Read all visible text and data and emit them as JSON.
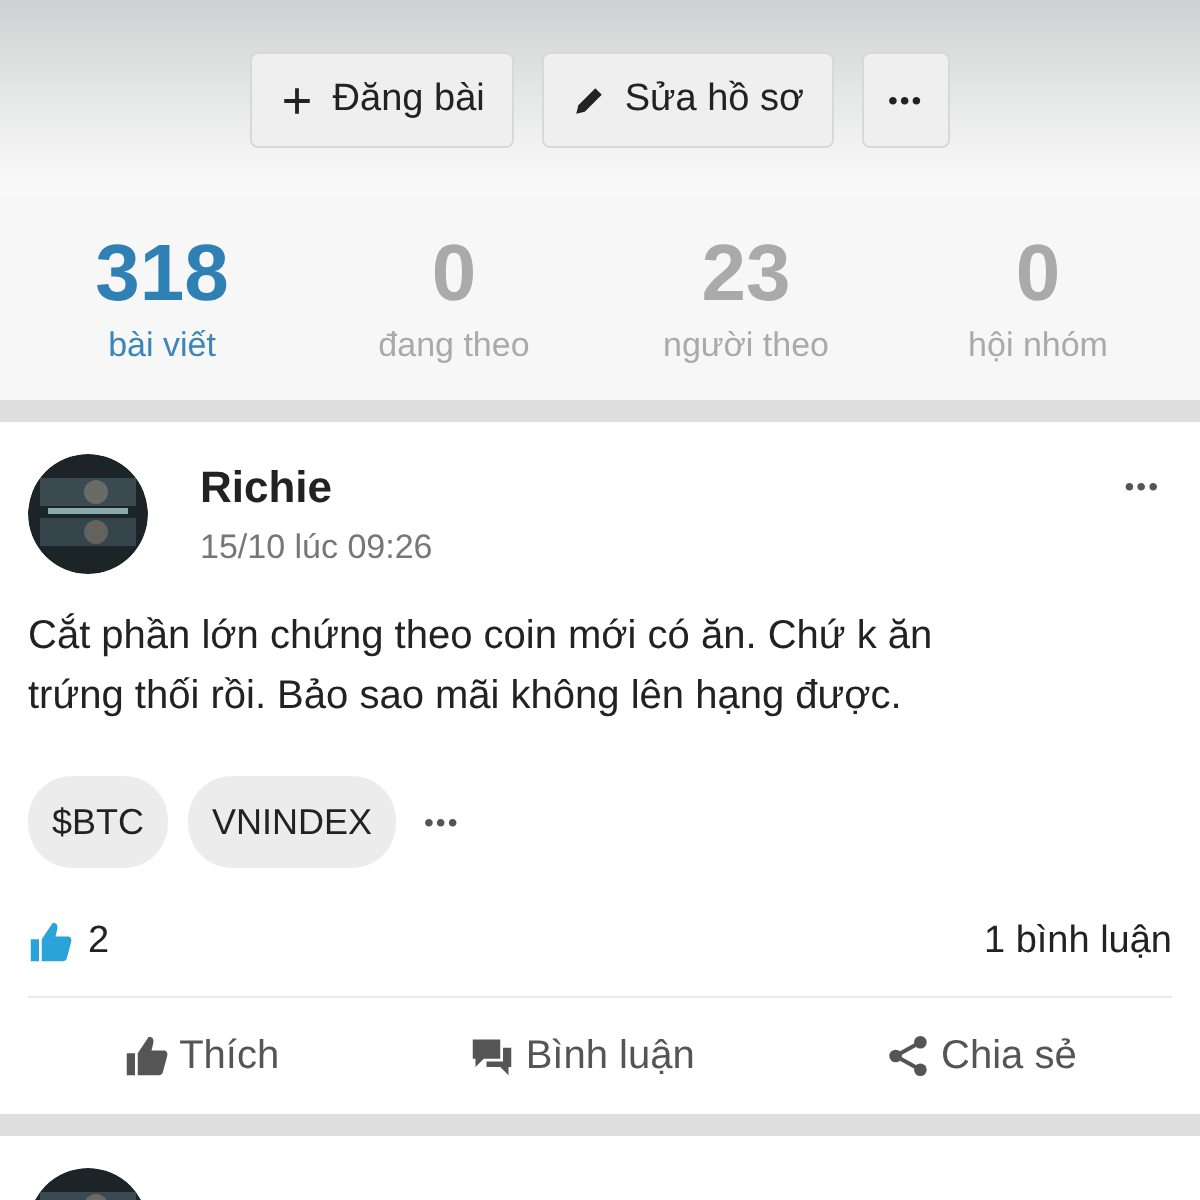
{
  "actions": [
    {
      "kind": "add",
      "label": "Đăng bài"
    },
    {
      "kind": "edit",
      "label": "Sửa hồ sơ"
    },
    {
      "kind": "more",
      "label": "•••"
    }
  ],
  "stats": [
    {
      "value": "318",
      "label": "bài viết",
      "selected": true
    },
    {
      "value": "0",
      "label": "đang theo",
      "selected": false
    },
    {
      "value": "23",
      "label": "người theo",
      "selected": false
    },
    {
      "value": "0",
      "label": "hội nhóm",
      "selected": false
    }
  ],
  "posts": [
    {
      "author": "Richie",
      "time": "15/10 lúc 09:26",
      "more": "•••",
      "text": "Cắt phần lớn chứng theo coin mới có ăn. Chứ k ăn trứng thối rồi. Bảo sao mãi không lên hạng được.",
      "tags": [
        "$BTC",
        "VNINDEX"
      ],
      "tags_more": "•••",
      "likes": "2",
      "comments": "1 bình luận",
      "buttons": [
        {
          "kind": "like",
          "label": "Thích"
        },
        {
          "kind": "comment",
          "label": "Bình luận"
        },
        {
          "kind": "share",
          "label": "Chia sẻ"
        }
      ]
    }
  ],
  "next_post_below": true
}
